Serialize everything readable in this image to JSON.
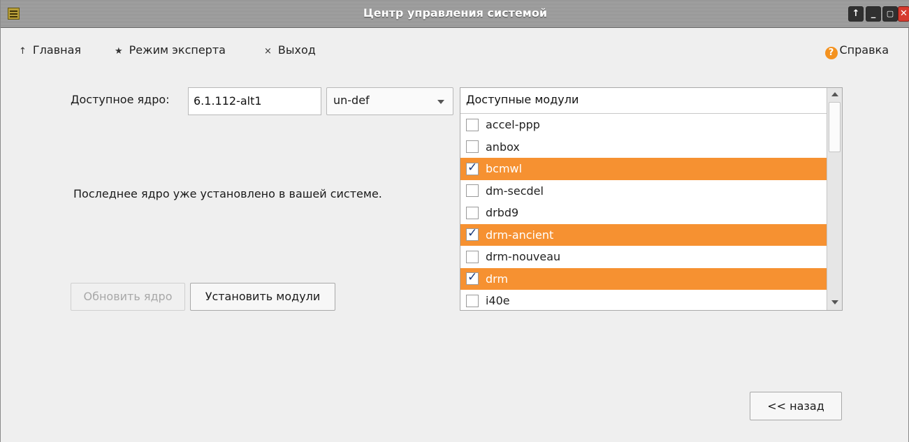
{
  "window": {
    "title": "Центр управления системой"
  },
  "menu": {
    "home": "Главная",
    "expert": "Режим эксперта",
    "exit": "Выход",
    "help": "Справка",
    "home_glyph": "↑",
    "expert_glyph": "★",
    "exit_glyph": "×"
  },
  "kernel": {
    "label": "Доступное ядро:",
    "version": "6.1.112-alt1",
    "flavour": "un-def"
  },
  "status": "Последнее ядро уже установлено в вашей системе.",
  "buttons": {
    "update": "Обновить ядро",
    "install": "Установить модули",
    "back": "<< назад"
  },
  "modules": {
    "header": "Доступные модули",
    "items": [
      {
        "name": "accel-ppp",
        "checked": false
      },
      {
        "name": "anbox",
        "checked": false
      },
      {
        "name": "bcmwl",
        "checked": true
      },
      {
        "name": "dm-secdel",
        "checked": false
      },
      {
        "name": "drbd9",
        "checked": false
      },
      {
        "name": "drm-ancient",
        "checked": true
      },
      {
        "name": "drm-nouveau",
        "checked": false
      },
      {
        "name": "drm",
        "checked": true
      },
      {
        "name": "i40e",
        "checked": false
      }
    ]
  },
  "colors": {
    "selection": "#f69131",
    "close_button": "#d63b2f",
    "help_icon": "#f4921f"
  }
}
